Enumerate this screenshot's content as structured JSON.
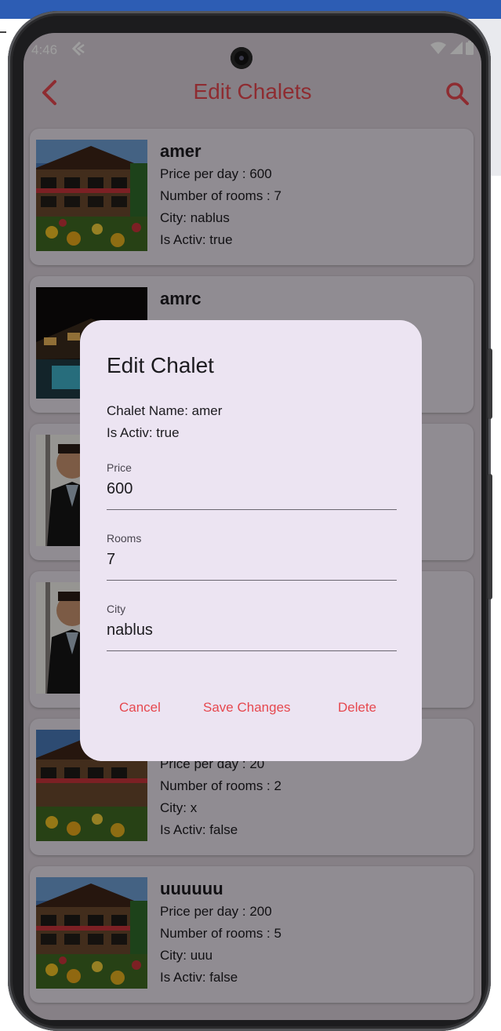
{
  "status_bar": {
    "time": "4:46"
  },
  "app_bar": {
    "title": "Edit Chalets"
  },
  "chalets": [
    {
      "name": "amer",
      "price": "Price per day : 600",
      "rooms": "Number of rooms : 7",
      "city": "City: nablus",
      "active": "Is Activ: true",
      "image": "chalet-house"
    },
    {
      "name": "amrc",
      "price": "",
      "rooms": "",
      "city": "",
      "active": "",
      "image": "chalet-night-pool"
    },
    {
      "name": "",
      "price": "",
      "rooms": "",
      "city": "",
      "active": "",
      "image": "person-photo"
    },
    {
      "name": "",
      "price": "",
      "rooms": "",
      "city": "",
      "active": "",
      "image": "person-photo"
    },
    {
      "name": "",
      "price": "Price per day : 20",
      "rooms": "Number of rooms : 2",
      "city": "City: x",
      "active": "Is Activ: false",
      "image": "chalet-house"
    },
    {
      "name": "uuuuuu",
      "price": "Price per day : 200",
      "rooms": "Number of rooms : 5",
      "city": "City: uuu",
      "active": "Is Activ: false",
      "image": "chalet-house"
    }
  ],
  "dialog": {
    "title": "Edit Chalet",
    "chalet_name": "Chalet Name: amer",
    "is_active": "Is Activ: true",
    "fields": {
      "price": {
        "label": "Price",
        "value": "600"
      },
      "rooms": {
        "label": "Rooms",
        "value": "7"
      },
      "city": {
        "label": "City",
        "value": "nablus"
      }
    },
    "actions": {
      "cancel": "Cancel",
      "save": "Save Changes",
      "delete": "Delete"
    }
  },
  "colors": {
    "accent": "#e6484f",
    "dialog_surface": "#ece4f2",
    "card_surface": "#e9e2ec",
    "scrim": "rgba(0,0,0,0.38)"
  },
  "icons": {
    "back": "chevron-left-icon",
    "search": "search-icon",
    "wifi": "wifi-icon",
    "signal": "signal-icon",
    "battery": "battery-icon"
  }
}
